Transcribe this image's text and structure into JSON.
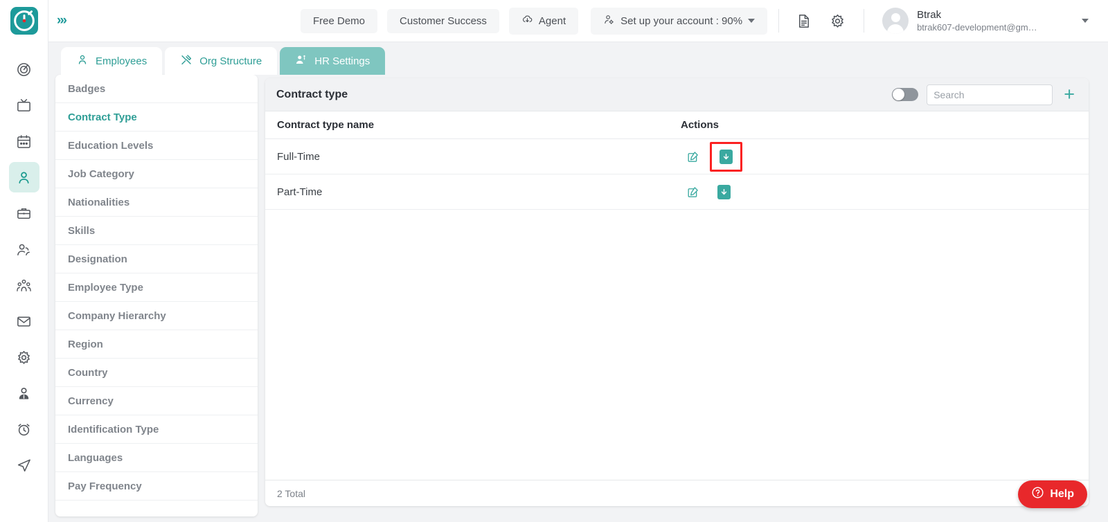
{
  "brand": {
    "accent": "#2f9e96",
    "logo_icon": "clock-logo-icon",
    "expand_icon": "chevrons-right-icon"
  },
  "topbar": {
    "buttons": [
      {
        "label": "Free Demo",
        "icon": null
      },
      {
        "label": "Customer Success",
        "icon": null
      },
      {
        "label": "Agent",
        "icon": "cloud-download-icon"
      }
    ],
    "setup": {
      "label": "Set up your account : 90%",
      "icon": "user-gear-icon",
      "percent": "90%"
    },
    "icons": [
      "document-icon",
      "gear-icon"
    ],
    "user": {
      "name": "Btrak",
      "email": "btrak607-development@gm…",
      "avatar": "avatar-placeholder-icon"
    }
  },
  "rail": {
    "items": [
      {
        "name": "dashboard-target-icon",
        "active": false
      },
      {
        "name": "monitor-icon",
        "active": false
      },
      {
        "name": "calendar-icon",
        "active": false
      },
      {
        "name": "person-icon",
        "active": true
      },
      {
        "name": "briefcase-icon",
        "active": false
      },
      {
        "name": "two-people-icon",
        "active": false
      },
      {
        "name": "group-people-icon",
        "active": false
      },
      {
        "name": "mail-icon",
        "active": false
      },
      {
        "name": "settings-gear-icon",
        "active": false
      },
      {
        "name": "user-badge-icon",
        "active": false
      },
      {
        "name": "alarm-clock-icon",
        "active": false
      },
      {
        "name": "send-arrow-icon",
        "active": false
      }
    ]
  },
  "tabs": [
    {
      "label": "Employees",
      "icon": "person-icon",
      "active": false
    },
    {
      "label": "Org Structure",
      "icon": "tools-icon",
      "active": false
    },
    {
      "label": "HR Settings",
      "icon": "people-settings-icon",
      "active": true
    }
  ],
  "sidebar": {
    "items": [
      {
        "label": "Badges",
        "active": false
      },
      {
        "label": "Contract Type",
        "active": true
      },
      {
        "label": "Education Levels",
        "active": false
      },
      {
        "label": "Job Category",
        "active": false
      },
      {
        "label": "Nationalities",
        "active": false
      },
      {
        "label": "Skills",
        "active": false
      },
      {
        "label": "Designation",
        "active": false
      },
      {
        "label": "Employee Type",
        "active": false
      },
      {
        "label": "Company Hierarchy",
        "active": false
      },
      {
        "label": "Region",
        "active": false
      },
      {
        "label": "Country",
        "active": false
      },
      {
        "label": "Currency",
        "active": false
      },
      {
        "label": "Identification Type",
        "active": false
      },
      {
        "label": "Languages",
        "active": false
      },
      {
        "label": "Pay Frequency",
        "active": false
      }
    ]
  },
  "panel": {
    "title": "Contract type",
    "toggle_on": false,
    "search_placeholder": "Search",
    "search_value": "",
    "add_label": "+",
    "columns": {
      "name": "Contract type name",
      "actions": "Actions"
    },
    "rows": [
      {
        "name": "Full-Time",
        "edit_icon": "edit-pencil-icon",
        "archive_icon": "archive-download-icon",
        "highlighted": true
      },
      {
        "name": "Part-Time",
        "edit_icon": "edit-pencil-icon",
        "archive_icon": "archive-download-icon",
        "highlighted": false
      }
    ],
    "footer": "2 Total"
  },
  "help": {
    "label": "Help",
    "icon": "question-circle-icon",
    "color": "#e8282b"
  }
}
